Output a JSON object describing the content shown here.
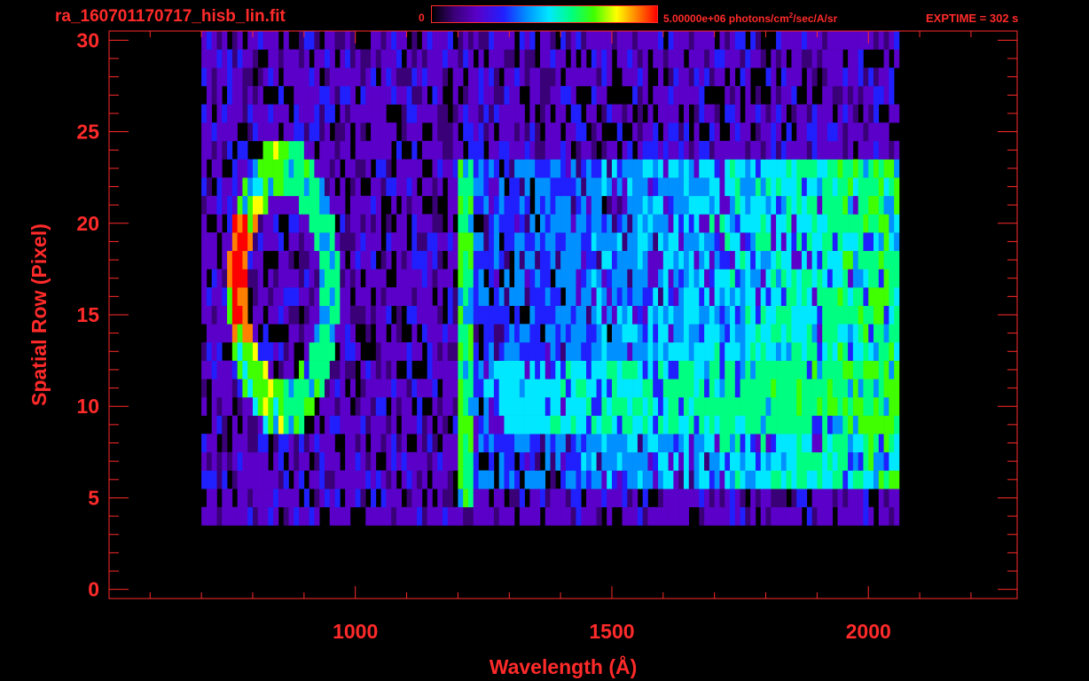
{
  "header": {
    "title": "ra_160701170717_hisb_lin.fit",
    "colorbar_min": "0",
    "colorbar_max_pre": "5.00000e+06 photons/cm",
    "colorbar_max_sup": "2",
    "colorbar_max_post": "/sec/A/sr",
    "exptime": "EXPTIME = 302 s"
  },
  "colors": {
    "axis": "#ff2a2a",
    "background": "#000000",
    "colormap": [
      "#000000",
      "#3a0078",
      "#5a00c8",
      "#2020ff",
      "#0090ff",
      "#00e8ff",
      "#00ff80",
      "#40ff00",
      "#ffff00",
      "#ff8000",
      "#ff0000"
    ]
  },
  "chart_data": {
    "type": "heatmap",
    "xlabel": "Wavelength (Å)",
    "ylabel": "Spatial Row (Pixel)",
    "xlim": [
      520,
      2290
    ],
    "ylim": [
      -0.5,
      30.5
    ],
    "x_ticks": [
      1000,
      1500,
      2000
    ],
    "y_ticks": [
      0,
      5,
      10,
      15,
      20,
      25,
      30
    ],
    "grid": false,
    "color_range": [
      0,
      5000000
    ],
    "color_unit": "photons/cm^2/sec/A/sr",
    "data_extent_x": [
      700,
      2060
    ],
    "data_rows": [
      4,
      30
    ],
    "features": [
      {
        "label_hidden": true,
        "kind": "ring",
        "x_range": [
          780,
          960
        ],
        "y_range": [
          10,
          23
        ],
        "peak_x": 790,
        "peak_y_range": [
          14,
          20
        ]
      },
      {
        "label_hidden": true,
        "kind": "vertical_line",
        "x": 1216,
        "y_range": [
          5,
          23
        ]
      },
      {
        "label_hidden": true,
        "kind": "band",
        "x_range": [
          1230,
          2060
        ],
        "y_range": [
          6,
          23
        ]
      },
      {
        "label_hidden": true,
        "kind": "band",
        "x_range": [
          1250,
          2060
        ],
        "y_range": [
          9,
          12
        ]
      }
    ]
  }
}
